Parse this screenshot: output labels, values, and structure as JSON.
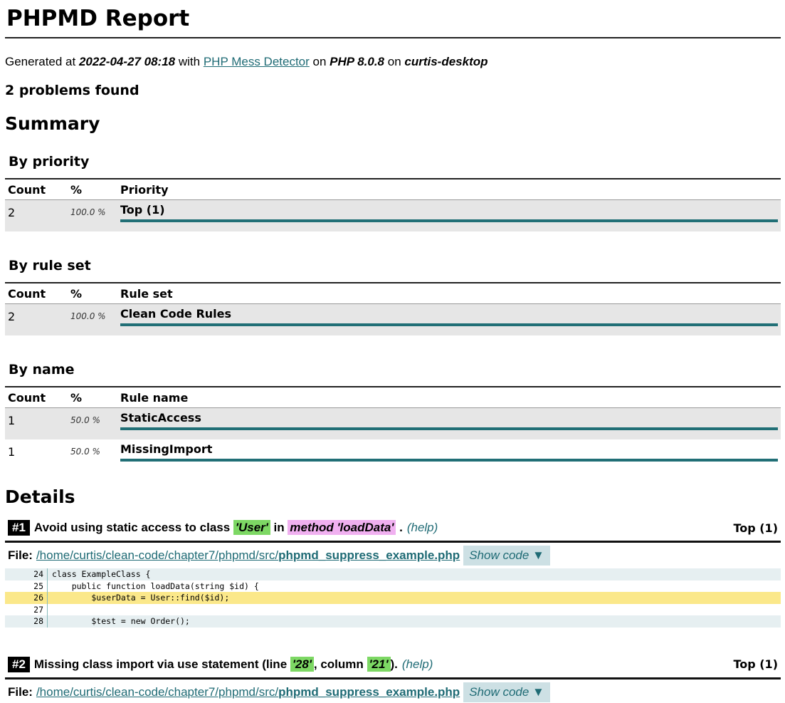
{
  "title": "PHPMD Report",
  "generated": {
    "prefix": "Generated at ",
    "datetime": "2022-04-27 08:18",
    "with": " with ",
    "tool_link": "PHP Mess Detector",
    "on1": " on ",
    "php_version": "PHP 8.0.8",
    "on2": " on ",
    "host": "curtis-desktop"
  },
  "problems_found": "2 problems found",
  "summary": {
    "title": "Summary",
    "tables": [
      {
        "title": "By priority",
        "headers": [
          "Count",
          "%",
          "Priority"
        ],
        "rows": [
          {
            "count": "2",
            "percent": "100.0 %",
            "label": "Top (1)",
            "fraction": 1.0
          }
        ]
      },
      {
        "title": "By rule set",
        "headers": [
          "Count",
          "%",
          "Rule set"
        ],
        "rows": [
          {
            "count": "2",
            "percent": "100.0 %",
            "label": "Clean Code Rules",
            "fraction": 1.0
          }
        ]
      },
      {
        "title": "By name",
        "headers": [
          "Count",
          "%",
          "Rule name"
        ],
        "rows": [
          {
            "count": "1",
            "percent": "50.0 %",
            "label": "StaticAccess",
            "fraction": 1.0
          },
          {
            "count": "1",
            "percent": "50.0 %",
            "label": "MissingImport",
            "fraction": 1.0
          }
        ]
      }
    ]
  },
  "details": {
    "title": "Details",
    "violations": [
      {
        "number": "#1",
        "parts": [
          {
            "text": "Avoid using static access to class ",
            "style": "plain"
          },
          {
            "text": "'User'",
            "style": "green"
          },
          {
            "text": " in ",
            "style": "plain"
          },
          {
            "text": "method 'loadData'",
            "style": "pink"
          },
          {
            "text": " .",
            "style": "plain"
          }
        ],
        "help": "(help)",
        "priority": "Top (1)",
        "file_label": "File:",
        "file_dir": "/home/curtis/clean-code/chapter7/phpmd/src/",
        "file_name": "phpmd_suppress_example.php",
        "show_code": "Show code ▼",
        "code": [
          {
            "line": "24",
            "text": "class ExampleClass {",
            "highlight": false
          },
          {
            "line": "25",
            "text": "    public function loadData(string $id) {",
            "highlight": false
          },
          {
            "line": "26",
            "text": "        $userData = User::find($id);",
            "highlight": true
          },
          {
            "line": "27",
            "text": "",
            "highlight": false
          },
          {
            "line": "28",
            "text": "        $test = new Order();",
            "highlight": false
          }
        ]
      },
      {
        "number": "#2",
        "parts": [
          {
            "text": "Missing class import via use statement (line ",
            "style": "plain"
          },
          {
            "text": "'28'",
            "style": "green"
          },
          {
            "text": ", column ",
            "style": "plain"
          },
          {
            "text": "'21'",
            "style": "green"
          },
          {
            "text": ").",
            "style": "plain"
          }
        ],
        "help": "(help)",
        "priority": "Top (1)",
        "file_label": "File:",
        "file_dir": "/home/curtis/clean-code/chapter7/phpmd/src/",
        "file_name": "phpmd_suppress_example.php",
        "show_code": "Show code ▼",
        "code": []
      }
    ]
  },
  "colors": {
    "accent": "#216f76",
    "link": "#1f6b75",
    "highlight_green": "#7dd864",
    "highlight_pink": "#f0b0f0",
    "code_highlight": "#fbe88a",
    "row_alt": "#e6e6e6"
  }
}
